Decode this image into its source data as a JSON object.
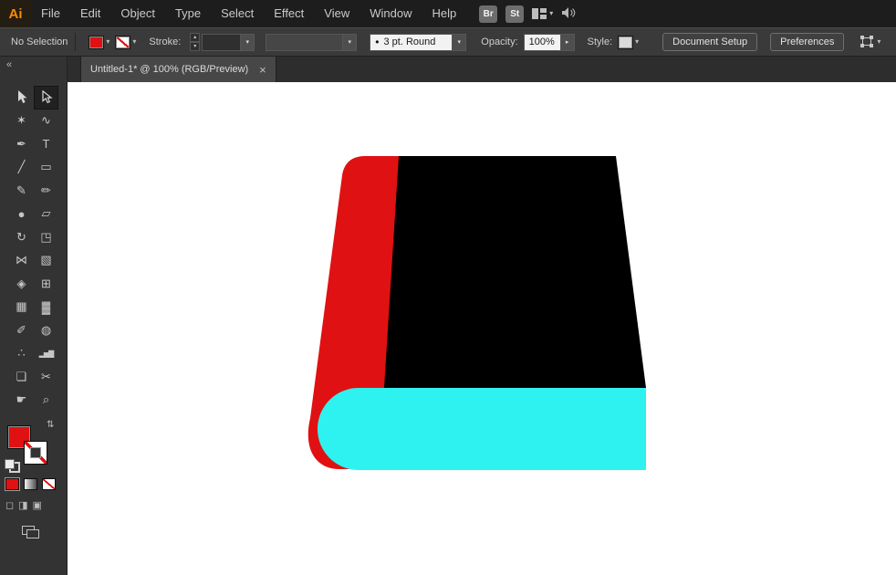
{
  "menu_bar": {
    "logo": "Ai",
    "items": [
      "File",
      "Edit",
      "Object",
      "Type",
      "Select",
      "Effect",
      "View",
      "Window",
      "Help"
    ],
    "bridge_label": "Br",
    "stock_label": "St"
  },
  "control_bar": {
    "selection_status": "No Selection",
    "fill_color": "#e01112",
    "stroke_color": "none",
    "stroke_label": "Stroke:",
    "stroke_weight_value": "",
    "brush_preview": "•",
    "brush_value": "3 pt. Round",
    "opacity_label": "Opacity:",
    "opacity_value": "100%",
    "style_label": "Style:",
    "document_setup_label": "Document Setup",
    "preferences_label": "Preferences"
  },
  "tab_bar": {
    "tab_title": "Untitled-1* @ 100% (RGB/Preview)",
    "close_label": "×"
  },
  "toolbar": {
    "active_tool": "direct-selection-tool",
    "fill_color": "#e01112",
    "stroke_color": "none",
    "tools": [
      {
        "id": "selection-tool"
      },
      {
        "id": "direct-selection-tool"
      },
      {
        "id": "magic-wand-tool",
        "glyph": "✶"
      },
      {
        "id": "lasso-tool",
        "glyph": "∿"
      },
      {
        "id": "pen-tool",
        "glyph": "✒"
      },
      {
        "id": "type-tool",
        "glyph": "T"
      },
      {
        "id": "line-segment-tool",
        "glyph": "╱"
      },
      {
        "id": "rectangle-tool",
        "glyph": "▭"
      },
      {
        "id": "paintbrush-tool",
        "glyph": "✎"
      },
      {
        "id": "pencil-tool",
        "glyph": "✏"
      },
      {
        "id": "blob-brush-tool",
        "glyph": "●"
      },
      {
        "id": "eraser-tool",
        "glyph": "▱"
      },
      {
        "id": "rotate-tool",
        "glyph": "↻"
      },
      {
        "id": "scale-tool",
        "glyph": "◳"
      },
      {
        "id": "width-tool",
        "glyph": "⋈"
      },
      {
        "id": "free-transform-tool",
        "glyph": "▧"
      },
      {
        "id": "shape-builder-tool",
        "glyph": "◈"
      },
      {
        "id": "perspective-grid-tool",
        "glyph": "⊞"
      },
      {
        "id": "mesh-tool",
        "glyph": "▦"
      },
      {
        "id": "gradient-tool",
        "glyph": "▓"
      },
      {
        "id": "eyedropper-tool",
        "glyph": "✐"
      },
      {
        "id": "blend-tool",
        "glyph": "◍"
      },
      {
        "id": "symbol-sprayer-tool",
        "glyph": "∴"
      },
      {
        "id": "column-graph-tool",
        "glyph": "▂▅▇"
      },
      {
        "id": "artboard-tool",
        "glyph": "❏"
      },
      {
        "id": "slice-tool",
        "glyph": "✂"
      },
      {
        "id": "hand-tool",
        "glyph": "☛"
      },
      {
        "id": "zoom-tool",
        "glyph": "⌕"
      }
    ],
    "drawing_modes": [
      {
        "id": "draw-normal",
        "glyph": "◻"
      },
      {
        "id": "draw-behind",
        "glyph": "◨"
      },
      {
        "id": "draw-inside",
        "glyph": "▣"
      }
    ]
  },
  "icons": {
    "chevron_down": "▾",
    "chevron_right": "▸",
    "spin_up": "▴",
    "spin_down": "▾",
    "swap_arrows": "⇅",
    "collapse_panel": "«"
  },
  "canvas": {
    "artwork": {
      "spine_color": "#e01112",
      "cover_color": "#000000",
      "pages_color": "#2ef2f0"
    }
  }
}
